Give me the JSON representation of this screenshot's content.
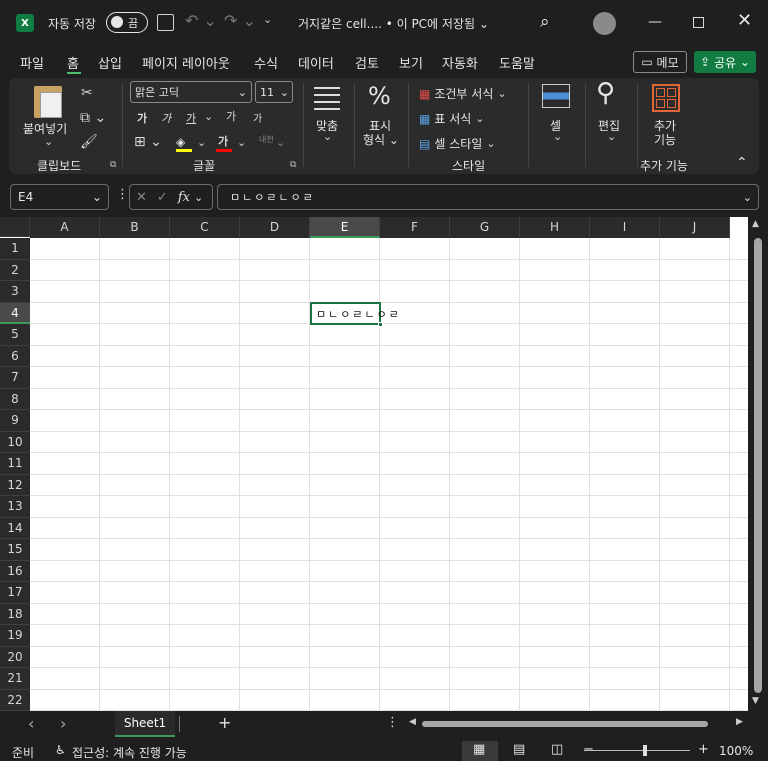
{
  "titlebar": {
    "app_icon": "X",
    "autosave_label": "자동 저장",
    "autosave_state": "끔",
    "more_commands": "⌄",
    "doc_title": "거지같은 cell....  • 이 PC에 저장됨 ⌄"
  },
  "menu": {
    "tabs": [
      "파일",
      "홈",
      "삽입",
      "페이지 레이아웃",
      "수식",
      "데이터",
      "검토",
      "보기",
      "자동화",
      "도움말"
    ],
    "comment_label": "메모",
    "share_label": "공유"
  },
  "ribbon": {
    "clipboard": {
      "paste": "붙여넣기",
      "group": "클립보드"
    },
    "font": {
      "name": "맑은 고딕",
      "size": "11",
      "group": "글꼴",
      "bold": "가",
      "italic": "가",
      "underline": "가",
      "increase": "가",
      "decrease": "가",
      "color_a": "가",
      "phonetic": "내천"
    },
    "alignment": {
      "label": "맞춤"
    },
    "number": {
      "label": "표시\n형식"
    },
    "styles": {
      "conditional": "조건부 서식",
      "table": "표 서식",
      "cell_style": "셀 스타일",
      "group": "스타일"
    },
    "cells": {
      "label": "셀"
    },
    "editing": {
      "label": "편집"
    },
    "addins": {
      "label": "추가\n기능",
      "group": "추가 기능"
    }
  },
  "formula_bar": {
    "name_box": "E4",
    "dots": "⋮",
    "cancel": "✕",
    "enter": "✓",
    "fx": "fx",
    "content": "ㅁㄴㅇㄹㄴㅇㄹ"
  },
  "grid": {
    "columns": [
      "A",
      "B",
      "C",
      "D",
      "E",
      "F",
      "G",
      "H",
      "I",
      "J"
    ],
    "rows": [
      "1",
      "2",
      "3",
      "4",
      "5",
      "6",
      "7",
      "8",
      "9",
      "10",
      "11",
      "12",
      "13",
      "14",
      "15",
      "16",
      "17",
      "18",
      "19",
      "20",
      "21",
      "22"
    ],
    "active_cell_value": "ㅁㄴㅇㄹㄴㅇㄹ"
  },
  "sheets": {
    "prev": "‹",
    "next": "›",
    "tab": "Sheet1",
    "add": "+"
  },
  "status": {
    "ready": "준비",
    "accessibility": "접근성: 계속 진행 가능",
    "zoom_out": "−",
    "zoom_in": "+",
    "zoom": "100%"
  }
}
